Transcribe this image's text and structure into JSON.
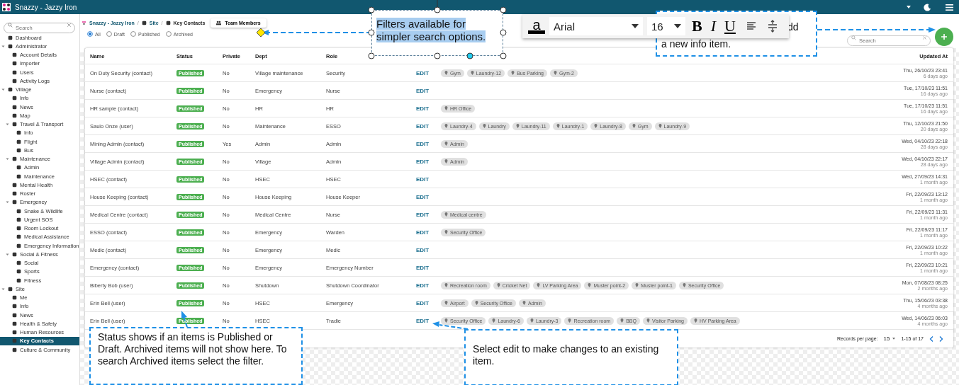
{
  "app_bar": {
    "title": "Snazzy - Jazzy Iron"
  },
  "sidebar": {
    "search": {
      "placeholder": "Search"
    },
    "items": [
      {
        "label": "Dashboard",
        "selected": false
      },
      {
        "label": "Administrator",
        "selected": false,
        "expanded": true,
        "children": [
          {
            "label": "Account Details",
            "selected": false
          },
          {
            "label": "Importer",
            "selected": false
          },
          {
            "label": "Users",
            "selected": false
          },
          {
            "label": "Activity Logs",
            "selected": false
          }
        ]
      },
      {
        "label": "Village",
        "selected": false,
        "expanded": true,
        "children": [
          {
            "label": "Info",
            "selected": false
          },
          {
            "label": "News",
            "selected": false
          },
          {
            "label": "Map",
            "selected": false
          },
          {
            "label": "Travel & Transport",
            "selected": false,
            "expanded": true,
            "children": [
              {
                "label": "Info",
                "selected": false
              },
              {
                "label": "Flight",
                "selected": false
              },
              {
                "label": "Bus",
                "selected": false
              }
            ]
          },
          {
            "label": "Maintenance",
            "selected": false,
            "expanded": true,
            "children": [
              {
                "label": "Admin",
                "selected": false
              },
              {
                "label": "Maintenance",
                "selected": false
              }
            ]
          },
          {
            "label": "Mental Health",
            "selected": false
          },
          {
            "label": "Roster",
            "selected": false
          },
          {
            "label": "Emergency",
            "selected": false,
            "expanded": true,
            "children": [
              {
                "label": "Snake & Wildlife",
                "selected": false
              },
              {
                "label": "Urgent SOS",
                "selected": false
              },
              {
                "label": "Room Lockout",
                "selected": false
              },
              {
                "label": "Medical Assistance",
                "selected": false
              },
              {
                "label": "Emergency Information",
                "selected": false
              }
            ]
          },
          {
            "label": "Social & Fitness",
            "selected": false,
            "expanded": true,
            "children": [
              {
                "label": "Social",
                "selected": false
              },
              {
                "label": "Sports",
                "selected": false
              },
              {
                "label": "Fitness",
                "selected": false
              }
            ]
          }
        ]
      },
      {
        "label": "Site",
        "selected": false,
        "expanded": true,
        "children": [
          {
            "label": "Me",
            "selected": false
          },
          {
            "label": "Info",
            "selected": false
          },
          {
            "label": "News",
            "selected": false
          },
          {
            "label": "Health & Safety",
            "selected": false
          },
          {
            "label": "Human Resources",
            "selected": false
          },
          {
            "label": "Key Contacts",
            "selected": true
          },
          {
            "label": "Culture & Community",
            "selected": false
          }
        ]
      }
    ]
  },
  "breadcrumb": [
    "Snazzy - Jazzy Iron",
    "Site",
    "Key Contacts"
  ],
  "breadcrumb_separator": "/",
  "team_members_button": "Team Members",
  "filters": [
    {
      "label": "All",
      "selected": true
    },
    {
      "label": "Draft",
      "selected": false
    },
    {
      "label": "Published",
      "selected": false
    },
    {
      "label": "Archived",
      "selected": false
    }
  ],
  "search": {
    "placeholder": "Search"
  },
  "table": {
    "columns": [
      "Name",
      "Status",
      "Private",
      "Dept",
      "Role",
      "Updated At"
    ],
    "rows": [
      {
        "name": "On Duty Security (contact)",
        "status": "Published",
        "private": "No",
        "dept": "Village maintenance",
        "role": "Security",
        "action": "EDIT",
        "locations": [
          "Gym",
          "Laundry-12",
          "Bus Parking",
          "Gym-2"
        ],
        "updated": "Thu, 26/10/23 23:41",
        "ago": "6 days ago"
      },
      {
        "name": "Nurse (contact)",
        "status": "Published",
        "private": "No",
        "dept": "Emergency",
        "role": "Nurse",
        "action": "EDIT",
        "locations": [],
        "updated": "Tue, 17/10/23 11:51",
        "ago": "16 days ago"
      },
      {
        "name": "HR sample (contact)",
        "status": "Published",
        "private": "No",
        "dept": "HR",
        "role": "HR",
        "action": "EDIT",
        "locations": [
          "HR Office"
        ],
        "updated": "Tue, 17/10/23 11:51",
        "ago": "16 days ago"
      },
      {
        "name": "Saulo Onze (user)",
        "status": "Published",
        "private": "No",
        "dept": "Maintenance",
        "role": "ESSO",
        "action": "EDIT",
        "locations": [
          "Laundry-4",
          "Laundry",
          "Laundry-11",
          "Laundry-1",
          "Laundry-8",
          "Gym",
          "Laundry-9"
        ],
        "updated": "Thu, 12/10/23 21:50",
        "ago": "20 days ago"
      },
      {
        "name": "Mining Admin (contact)",
        "status": "Published",
        "private": "Yes",
        "dept": "Admin",
        "role": "Admin",
        "action": "EDIT",
        "locations": [
          "Admin"
        ],
        "updated": "Wed, 04/10/23 22:18",
        "ago": "28 days ago"
      },
      {
        "name": "Village Admin (contact)",
        "status": "Published",
        "private": "No",
        "dept": "Village",
        "role": "Admin",
        "action": "EDIT",
        "locations": [
          "Admin"
        ],
        "updated": "Wed, 04/10/23 22:17",
        "ago": "28 days ago"
      },
      {
        "name": "HSEC (contact)",
        "status": "Published",
        "private": "No",
        "dept": "HSEC",
        "role": "HSEC",
        "action": "EDIT",
        "locations": [],
        "updated": "Wed, 27/09/23 14:31",
        "ago": "1 month ago"
      },
      {
        "name": "House Keeping (contact)",
        "status": "Published",
        "private": "No",
        "dept": "House Keeping",
        "role": "House Keeper",
        "action": "EDIT",
        "locations": [],
        "updated": "Fri, 22/09/23 13:12",
        "ago": "1 month ago"
      },
      {
        "name": "Medical Centre (contact)",
        "status": "Published",
        "private": "No",
        "dept": "Medical Centre",
        "role": "Nurse",
        "action": "EDIT",
        "locations": [
          "Medical centre"
        ],
        "updated": "Fri, 22/09/23 11:31",
        "ago": "1 month ago"
      },
      {
        "name": "ESSO (contact)",
        "status": "Published",
        "private": "No",
        "dept": "Emergency",
        "role": "Warden",
        "action": "EDIT",
        "locations": [
          "Security Office"
        ],
        "updated": "Fri, 22/09/23 11:17",
        "ago": "1 month ago"
      },
      {
        "name": "Medic (contact)",
        "status": "Published",
        "private": "No",
        "dept": "Emergency",
        "role": "Medic",
        "action": "EDIT",
        "locations": [],
        "updated": "Fri, 22/09/23 10:22",
        "ago": "1 month ago"
      },
      {
        "name": "Emergency (contact)",
        "status": "Published",
        "private": "No",
        "dept": "Emergency",
        "role": "Emergency Number",
        "action": "EDIT",
        "locations": [],
        "updated": "Fri, 22/09/23 10:21",
        "ago": "1 month ago"
      },
      {
        "name": "Biberty Bob (user)",
        "status": "Published",
        "private": "No",
        "dept": "Shutdown",
        "role": "Shutdown Coordinator",
        "action": "EDIT",
        "locations": [
          "Recreation room",
          "Cricket Net",
          "LV Parking Area",
          "Muster point-2",
          "Muster point-1",
          "Security Office"
        ],
        "updated": "Mon, 07/08/23 08:25",
        "ago": "2 months ago"
      },
      {
        "name": "Erin Bell (user)",
        "status": "Published",
        "private": "No",
        "dept": "HSEC",
        "role": "Emergency",
        "action": "EDIT",
        "locations": [
          "Airport",
          "Security Office",
          "Admin"
        ],
        "updated": "Thu, 15/06/23 03:38",
        "ago": "4 months ago"
      },
      {
        "name": "Erin Bell (user)",
        "status": "Published",
        "private": "No",
        "dept": "HSEC",
        "role": "Tradie",
        "action": "EDIT",
        "locations": [
          "Security Office",
          "Laundry-6",
          "Laundry-3",
          "Recreation room",
          "BBQ",
          "Visitor Parking",
          "HV Parking Area"
        ],
        "updated": "Wed, 14/06/23 06:03",
        "ago": "4 months ago"
      }
    ]
  },
  "pagination": {
    "label": "Records per page:",
    "per_page": "15",
    "range": "1-15 of 17"
  },
  "text_toolbar": {
    "font_color_letter": "a",
    "font": "Arial",
    "size": "16",
    "styles": [
      "B",
      "I",
      "U"
    ]
  },
  "callouts": [
    {
      "kind": "selected",
      "text": "Filters available for simpler search options."
    },
    {
      "kind": "covered",
      "lines": [
        "dd",
        "a new info item."
      ]
    },
    {
      "kind": "plain",
      "text": "Status shows if an items is Published or Draft. Archived items will not show here. To search Archived items select the filter."
    },
    {
      "kind": "plain",
      "text": "Select edit to make changes to an existing item."
    }
  ]
}
